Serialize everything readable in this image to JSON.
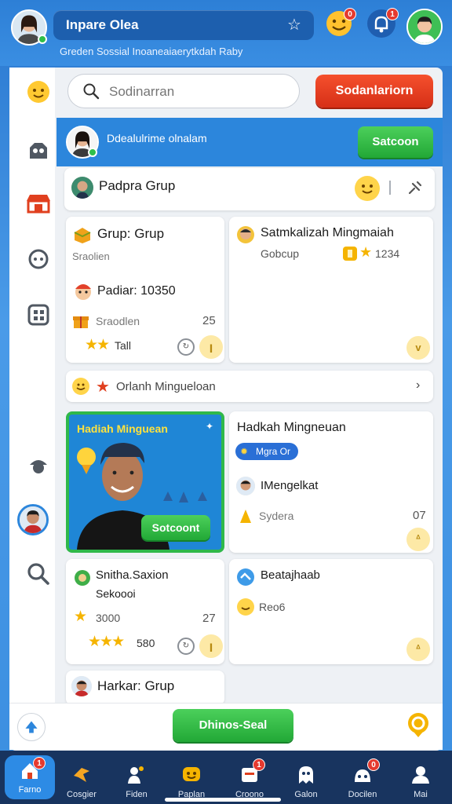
{
  "header": {
    "title": "Inpare Olea",
    "subtitle": "Greden Sossial Inoaneaiaerytkdah Raby",
    "badge_notif": "0",
    "badge_bell": "1"
  },
  "search": {
    "placeholder": "Sodinarran",
    "button": "Sodanlariorn"
  },
  "banner": {
    "text": "Ddealulrime olnalam",
    "button": "Satcoon"
  },
  "group_row": {
    "title": "Padpra Grup"
  },
  "cards": {
    "c1": {
      "title": "Grup: Grup",
      "sub": "Sraolien",
      "line2": "Padiar: 10350",
      "line3": "Sraodlen",
      "num": "25",
      "stars": "Tall"
    },
    "c2": {
      "title": "Satmkalizah Mingmaiah",
      "sub": "Gobcup",
      "points": "1234"
    },
    "notice": {
      "text": "Orlanh Mingueloan"
    },
    "featured": {
      "title": "Hadiah Minguean",
      "button": "Sotcoont"
    },
    "c3": {
      "title": "Hadkah Mingneuan",
      "pill": "Mgra Or",
      "line2": "IMengelkat",
      "line3": "Sydera",
      "num": "07"
    },
    "c4": {
      "title": "Snitha.Saxion",
      "sub": "Sekoooi",
      "line2": "3000",
      "num": "27",
      "stars": "580"
    },
    "c5": {
      "title": "Beatajhaab",
      "sub": "Reo6"
    },
    "c6": {
      "title": "Harkar: Grup"
    }
  },
  "bottom": {
    "button": "Dhinos-Seal"
  },
  "nav": [
    {
      "label": "Farno",
      "badge": "1"
    },
    {
      "label": "Cosgier"
    },
    {
      "label": "Fiden"
    },
    {
      "label": "Paplan"
    },
    {
      "label": "Croono",
      "badge": "1"
    },
    {
      "label": "Galon"
    },
    {
      "label": "Docilen",
      "badge": "0"
    },
    {
      "label": "Mai"
    }
  ],
  "colors": {
    "primary": "#2c86dc",
    "accent_red": "#e53a2f",
    "accent_green": "#2fb84a",
    "star": "#f5b400",
    "nav_bg": "#18345f"
  }
}
